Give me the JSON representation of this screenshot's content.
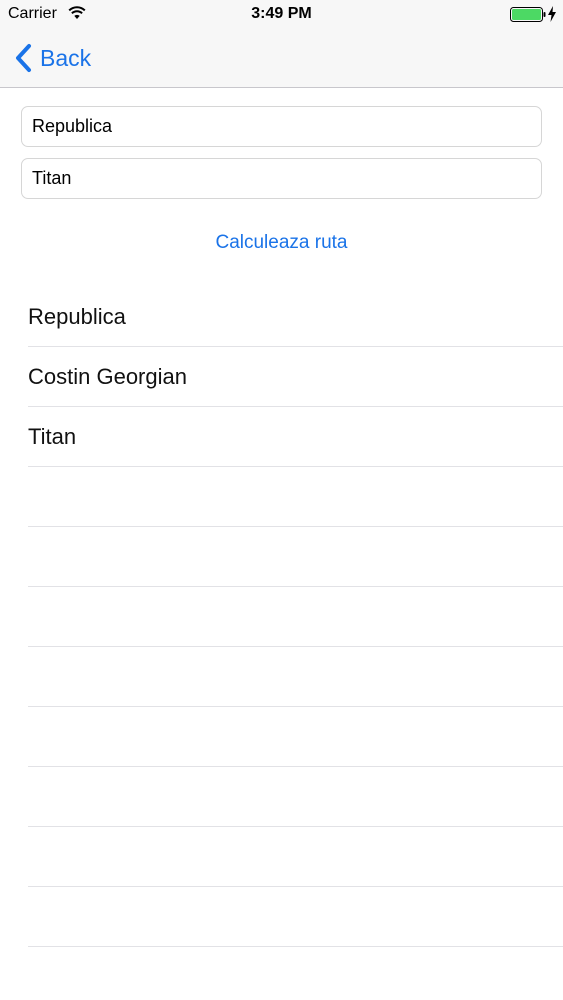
{
  "status_bar": {
    "carrier": "Carrier",
    "time": "3:49 PM",
    "battery_color": "#4cd964"
  },
  "nav": {
    "back_label": "Back",
    "accent_color": "#1a73e8"
  },
  "form": {
    "from_value": "Republica",
    "to_value": "Titan",
    "calc_label": "Calculeaza ruta"
  },
  "route": {
    "stops": [
      "Republica",
      "Costin Georgian",
      "Titan"
    ],
    "empty_rows": 8
  }
}
